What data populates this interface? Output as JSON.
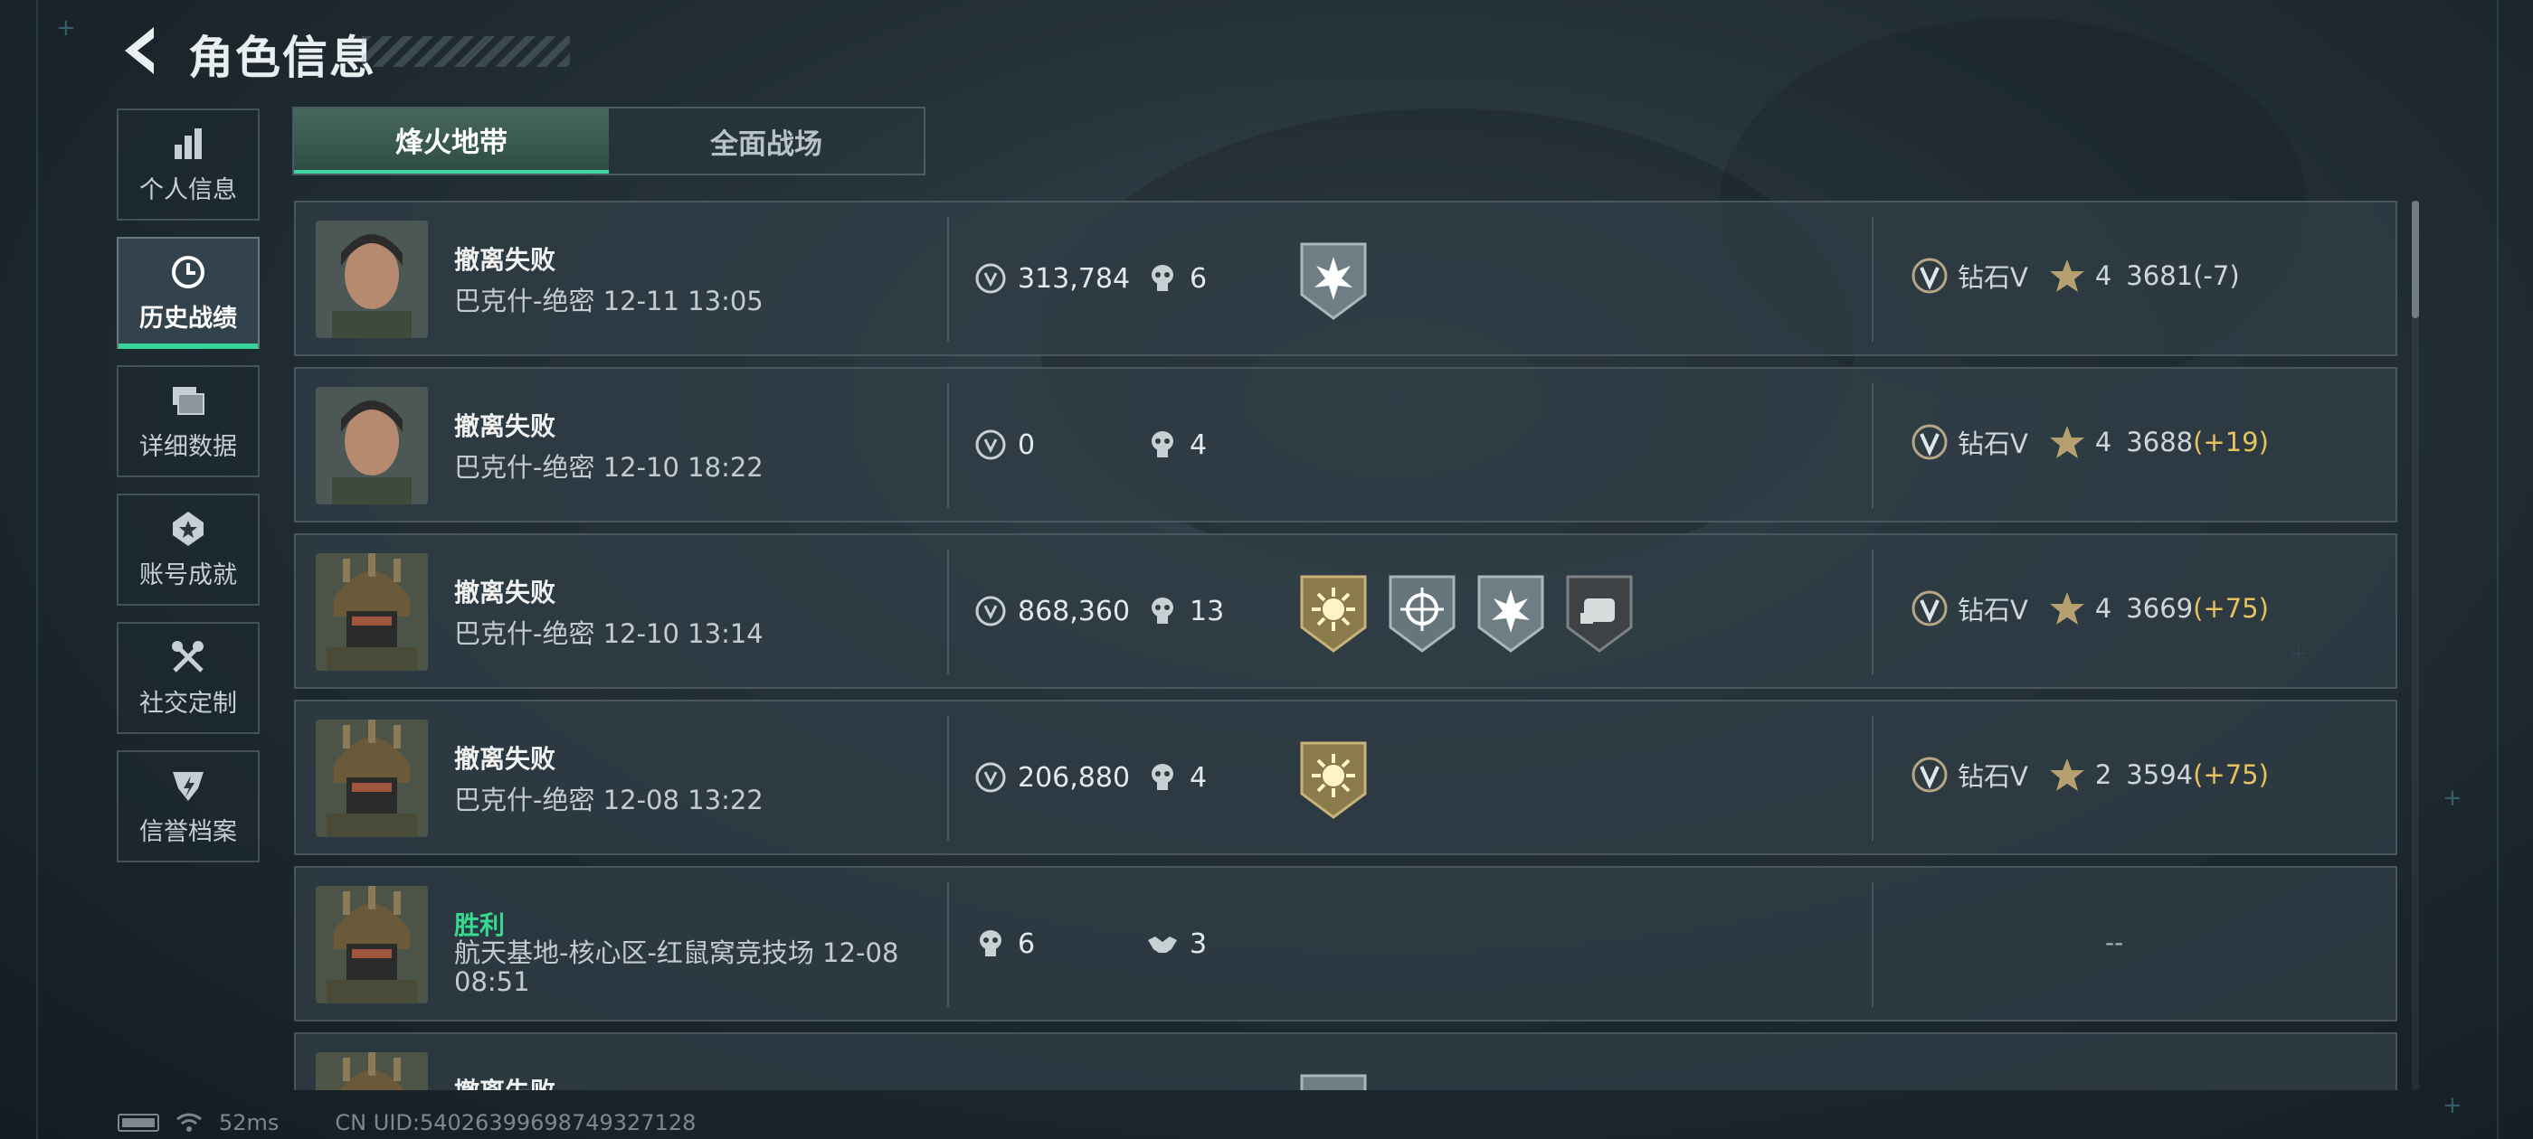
{
  "header": {
    "title": "角色信息"
  },
  "sidebar": {
    "items": [
      {
        "label": "个人信息",
        "icon": "bar-chart-icon",
        "active": false
      },
      {
        "label": "历史战绩",
        "icon": "history-clock-icon",
        "active": true
      },
      {
        "label": "详细数据",
        "icon": "layers-icon",
        "active": false
      },
      {
        "label": "账号成就",
        "icon": "achievement-icon",
        "active": false
      },
      {
        "label": "社交定制",
        "icon": "tools-icon",
        "active": false
      },
      {
        "label": "信誉档案",
        "icon": "reputation-icon",
        "active": false
      }
    ]
  },
  "tabs": [
    {
      "label": "烽火地带",
      "active": true
    },
    {
      "label": "全面战场",
      "active": false
    }
  ],
  "records": [
    {
      "result": "撤离失败",
      "win": false,
      "map": "巴克什-绝密 12-11 13:05",
      "value": "313,784",
      "kills": "6",
      "badges": [
        "silver-burst-badge"
      ],
      "rank": "钻石V",
      "stars": "4",
      "score": "3681",
      "delta": "(-7)",
      "delta_positive": false
    },
    {
      "result": "撤离失败",
      "win": false,
      "map": "巴克什-绝密 12-10 18:22",
      "value": "0",
      "kills": "4",
      "badges": [],
      "rank": "钻石V",
      "stars": "4",
      "score": "3688",
      "delta": "(+19)",
      "delta_positive": true
    },
    {
      "result": "撤离失败",
      "win": false,
      "map": "巴克什-绝密 12-10 13:14",
      "value": "868,360",
      "kills": "13",
      "badges": [
        "gold-sun-badge",
        "silver-crosshair-badge",
        "silver-burst-badge",
        "dark-fist-badge"
      ],
      "rank": "钻石V",
      "stars": "4",
      "score": "3669",
      "delta": "(+75)",
      "delta_positive": true
    },
    {
      "result": "撤离失败",
      "win": false,
      "map": "巴克什-绝密 12-08 13:22",
      "value": "206,880",
      "kills": "4",
      "badges": [
        "gold-sun-badge"
      ],
      "rank": "钻石V",
      "stars": "2",
      "score": "3594",
      "delta": "(+75)",
      "delta_positive": true
    },
    {
      "result": "胜利",
      "win": true,
      "map": "航天基地-核心区-红鼠窝竞技场 12-08 08:51",
      "kills": "6",
      "assists": "3",
      "rank_text": "--"
    },
    {
      "result": "撤离失败",
      "win": false
    }
  ],
  "footer": {
    "ping": "52ms",
    "uid": "CN UID:540263996987493271​28"
  },
  "colors": {
    "accent": "#36d49a",
    "win": "#36d98f",
    "positive_delta": "#e6c35c"
  }
}
